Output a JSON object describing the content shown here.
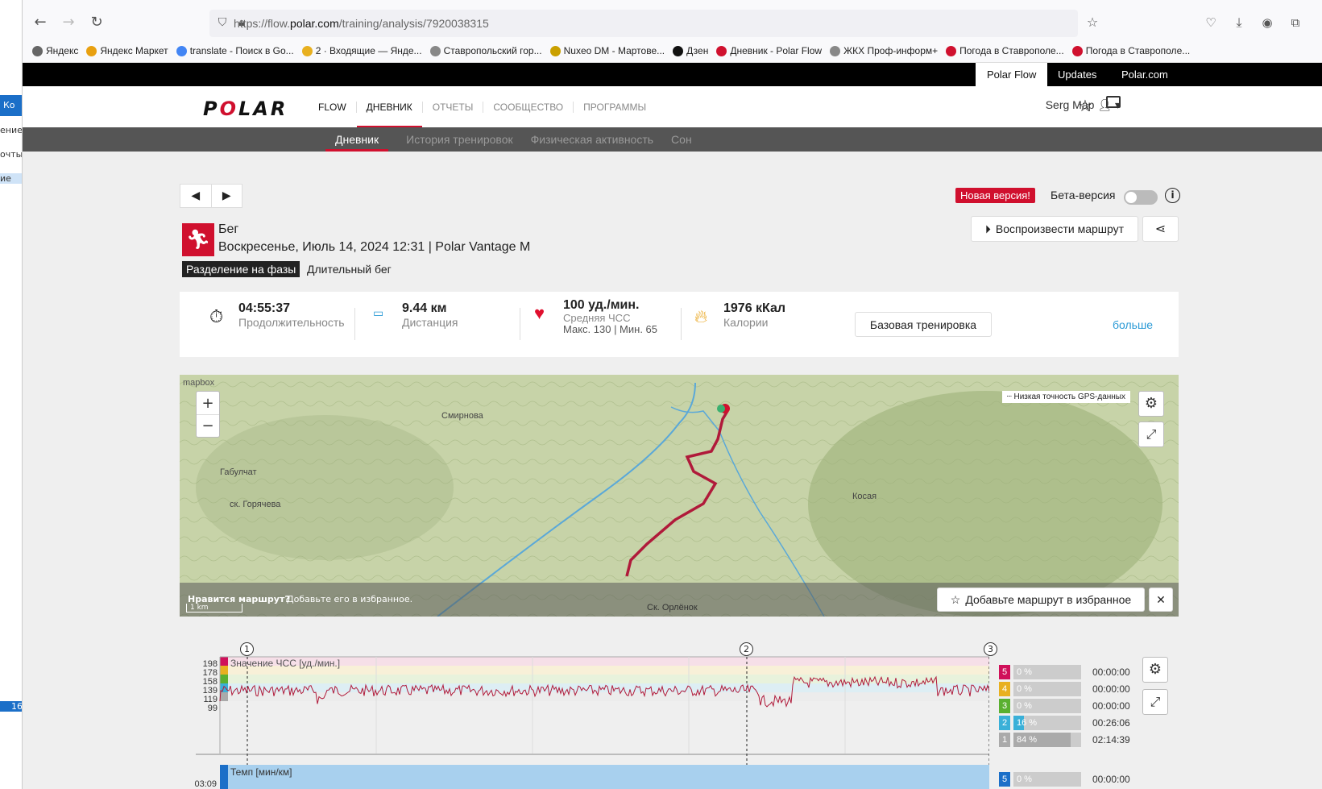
{
  "browser": {
    "url_prefix": "https://flow.",
    "url_domain": "polar.com",
    "url_path": "/training/analysis/7920038315",
    "bookmarks": [
      "Яндекс",
      "Яндекс Маркет",
      "translate - Поиск в Go...",
      "2 · Входящие — Янде...",
      "Ставропольский гор...",
      "Nuxeo DM - Мартове...",
      "Дзен",
      "Дневник - Polar Flow",
      "ЖКХ Проф-информ+",
      "Погода в Ставрополе...",
      "Погода в Ставрополе..."
    ]
  },
  "topbar": {
    "tabs": [
      "Polar Flow",
      "Updates",
      "Polar.com"
    ]
  },
  "header": {
    "logo": "POLAR",
    "nav": [
      "FLOW",
      "ДНЕВНИК",
      "ОТЧЕТЫ",
      "СООБЩЕСТВО",
      "ПРОГРАММЫ"
    ],
    "user": "Serg Map"
  },
  "subnav": [
    "Дневник",
    "История тренировок",
    "Физическая активность",
    "Сон"
  ],
  "controls": {
    "new_version": "Новая версия!",
    "beta": "Бета-версия",
    "replay": "Воспроизвести маршрут"
  },
  "session": {
    "sport": "Бег",
    "date": "Воскресенье, Июль 14, 2024 12:31 | Polar Vantage M",
    "phase_label": "Разделение на фазы",
    "target": "Длительный бег"
  },
  "summary": {
    "duration": "04:55:37",
    "duration_label": "Продолжительность",
    "distance": "9.44 км",
    "distance_label": "Дистанция",
    "hr": "100 уд./мин.",
    "hr_label": "Средняя ЧСС",
    "hr_minmax": "Макс. 130 | Мин. 65",
    "calories": "1976 кКал",
    "calories_label": "Калории",
    "base_button": "Базовая тренировка",
    "more": "больше"
  },
  "map": {
    "labels": [
      "Смирнова",
      "Габулчат",
      "ск. Горячева",
      "Косая",
      "Ск. Орлёнок"
    ],
    "gps_note": "Низкая точность GPS-данных",
    "like_route": "Нравится маршрут?",
    "add_fav_text": "Добавьте его в избранное.",
    "add_fav_button": "Добавьте маршрут в избранное",
    "scale": "1 km",
    "attribution": "mapbox"
  },
  "chart": {
    "hr_title": "Значение ЧСС [уд./мин.]",
    "hr_ticks": [
      "198",
      "178",
      "158",
      "139",
      "119",
      "99"
    ],
    "pace_title": "Темп [мин/км]",
    "pace_tick": "03:09",
    "laps": [
      "1",
      "2",
      "3"
    ]
  },
  "zones": [
    {
      "zone": "5",
      "pct": "0 %",
      "time": "00:00:00",
      "color": "#d0105a",
      "fill": 0
    },
    {
      "zone": "4",
      "pct": "0 %",
      "time": "00:00:00",
      "color": "#e8b020",
      "fill": 0
    },
    {
      "zone": "3",
      "pct": "0 %",
      "time": "00:00:00",
      "color": "#5ab030",
      "fill": 0
    },
    {
      "zone": "2",
      "pct": "16 %",
      "time": "00:26:06",
      "color": "#3ab0d8",
      "fill": 0.16
    },
    {
      "zone": "1",
      "pct": "84 %",
      "time": "02:14:39",
      "color": "#aaa",
      "fill": 0.84
    }
  ],
  "pace_zone": {
    "zone": "5",
    "pct": "0 %",
    "time": "00:00:00"
  }
}
